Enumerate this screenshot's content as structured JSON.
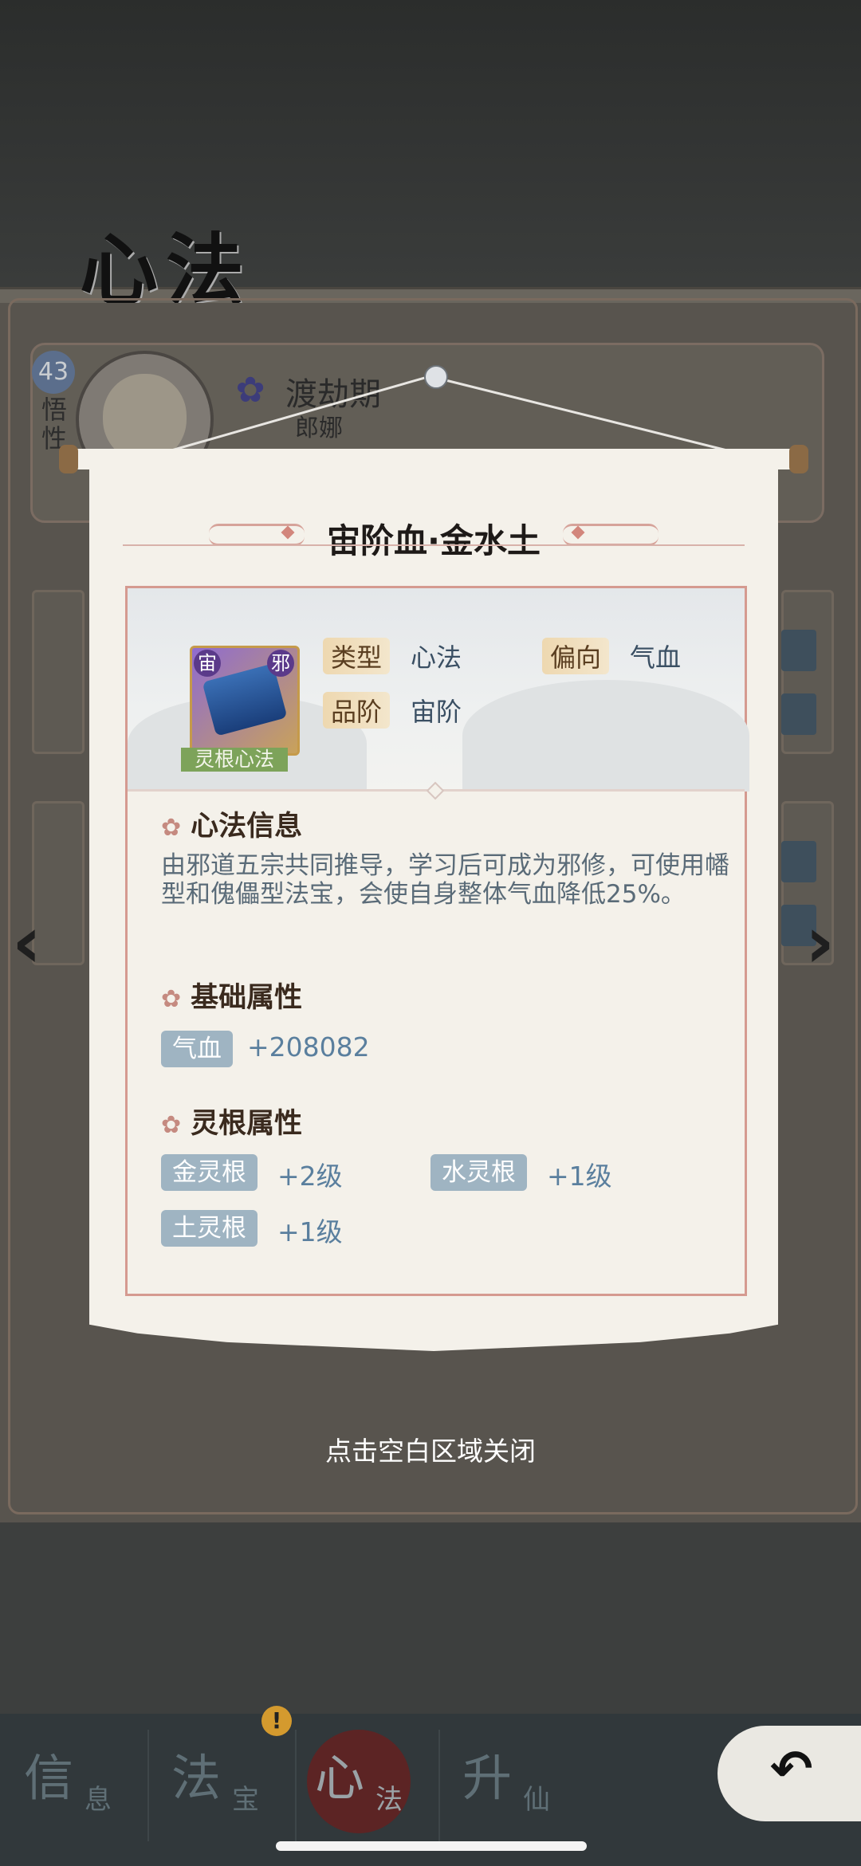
{
  "page": {
    "title": "心法",
    "dismiss_hint": "点击空白区域关闭"
  },
  "character": {
    "level": "43",
    "wuxing_label": "悟性",
    "realm": "渡劫期",
    "name": "郎娜",
    "realm_icon": "yin-yang-flower-icon"
  },
  "technique": {
    "title": "宙阶血·金水土",
    "icon": "evil-scroll-book-icon",
    "icon_badge_left": "宙",
    "icon_badge_right": "邪",
    "category_tag": "灵根心法",
    "attributes": {
      "type_label": "类型",
      "type_value": "心法",
      "bias_label": "偏向",
      "bias_value": "气血",
      "grade_label": "品阶",
      "grade_value": "宙阶"
    },
    "info_section": {
      "heading": "心法信息",
      "description": "由邪道五宗共同推导，学习后可成为邪修，可使用幡型和傀儡型法宝，会使自身整体气血降低25%。"
    },
    "base_section": {
      "heading": "基础属性",
      "stats": [
        {
          "label": "气血",
          "value": "+208082"
        }
      ]
    },
    "root_section": {
      "heading": "灵根属性",
      "roots": [
        {
          "label": "金灵根",
          "value": "+2级"
        },
        {
          "label": "水灵根",
          "value": "+1级"
        },
        {
          "label": "土灵根",
          "value": "+1级"
        }
      ]
    }
  },
  "tabs": [
    {
      "main": "信",
      "sub": "息"
    },
    {
      "main": "法",
      "sub": "宝"
    },
    {
      "main": "心",
      "sub": "法"
    },
    {
      "main": "升",
      "sub": "仙"
    }
  ],
  "tab_alert": "!",
  "colors": {
    "accent_pink": "#d59a90",
    "stat_tag_blue": "#9fb4c2",
    "stat_value_blue": "#5a7f9e",
    "active_tab": "#5c2424"
  }
}
